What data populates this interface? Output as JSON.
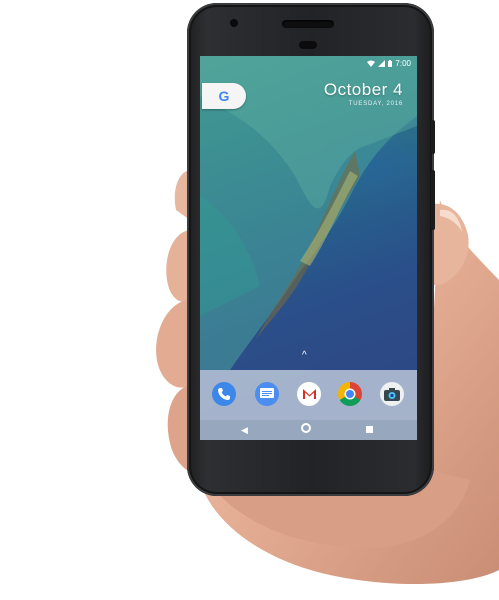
{
  "status_bar": {
    "time": "7:00",
    "icons": [
      "wifi-icon",
      "signal-icon",
      "battery-icon"
    ]
  },
  "search_widget": {
    "logo": "G",
    "icon": "google-icon"
  },
  "date_widget": {
    "date": "October 4",
    "subtext": "TUESDAY, 2016"
  },
  "drawer_handle": {
    "icon": "chevron-up-icon",
    "glyph": "^"
  },
  "dock": {
    "apps": [
      {
        "name": "phone-app",
        "icon": "phone-icon"
      },
      {
        "name": "messages-app",
        "icon": "messages-icon"
      },
      {
        "name": "gmail-app",
        "icon": "gmail-icon"
      },
      {
        "name": "chrome-app",
        "icon": "chrome-icon"
      },
      {
        "name": "camera-app",
        "icon": "camera-icon"
      }
    ]
  },
  "nav_bar": {
    "back_icon": "back-triangle-icon",
    "home_icon": "home-circle-icon",
    "recents_icon": "recents-square-icon"
  },
  "colors": {
    "phone_body": "#222326",
    "screen_teal": "#3b8f8a",
    "screen_blue": "#2c4682",
    "dock_bg": "#d2dce6",
    "google_blue": "#4285f4",
    "skin": "#e8b79f"
  }
}
